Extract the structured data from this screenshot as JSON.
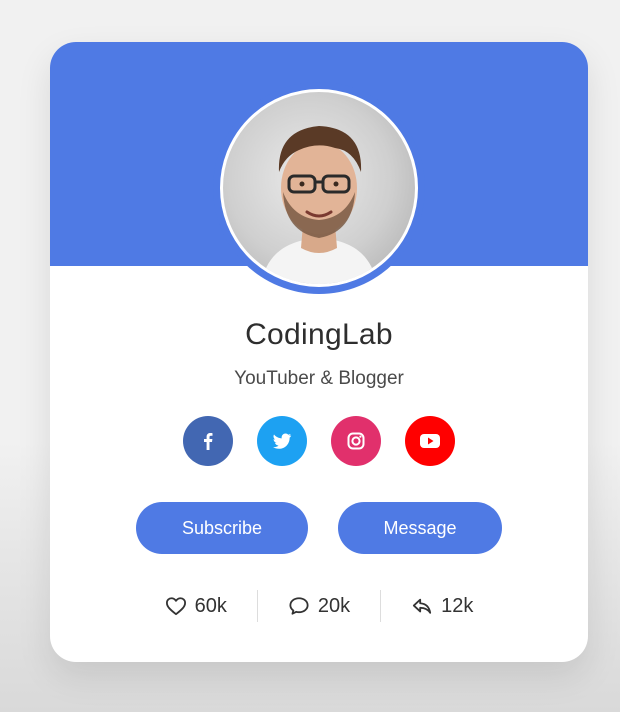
{
  "profile": {
    "name": "CodingLab",
    "role": "YouTuber & Blogger"
  },
  "colors": {
    "accent": "#4f7ae4",
    "facebook": "#4267b2",
    "twitter": "#1da1f2",
    "instagram": "#e1306c",
    "youtube": "#ff0000"
  },
  "socials": [
    {
      "name": "facebook",
      "icon": "facebook-icon"
    },
    {
      "name": "twitter",
      "icon": "twitter-icon"
    },
    {
      "name": "instagram",
      "icon": "instagram-icon"
    },
    {
      "name": "youtube",
      "icon": "youtube-icon"
    }
  ],
  "buttons": {
    "subscribe_label": "Subscribe",
    "message_label": "Message"
  },
  "stats": [
    {
      "icon": "heart-icon",
      "value": "60k"
    },
    {
      "icon": "comment-icon",
      "value": "20k"
    },
    {
      "icon": "share-icon",
      "value": "12k"
    }
  ]
}
